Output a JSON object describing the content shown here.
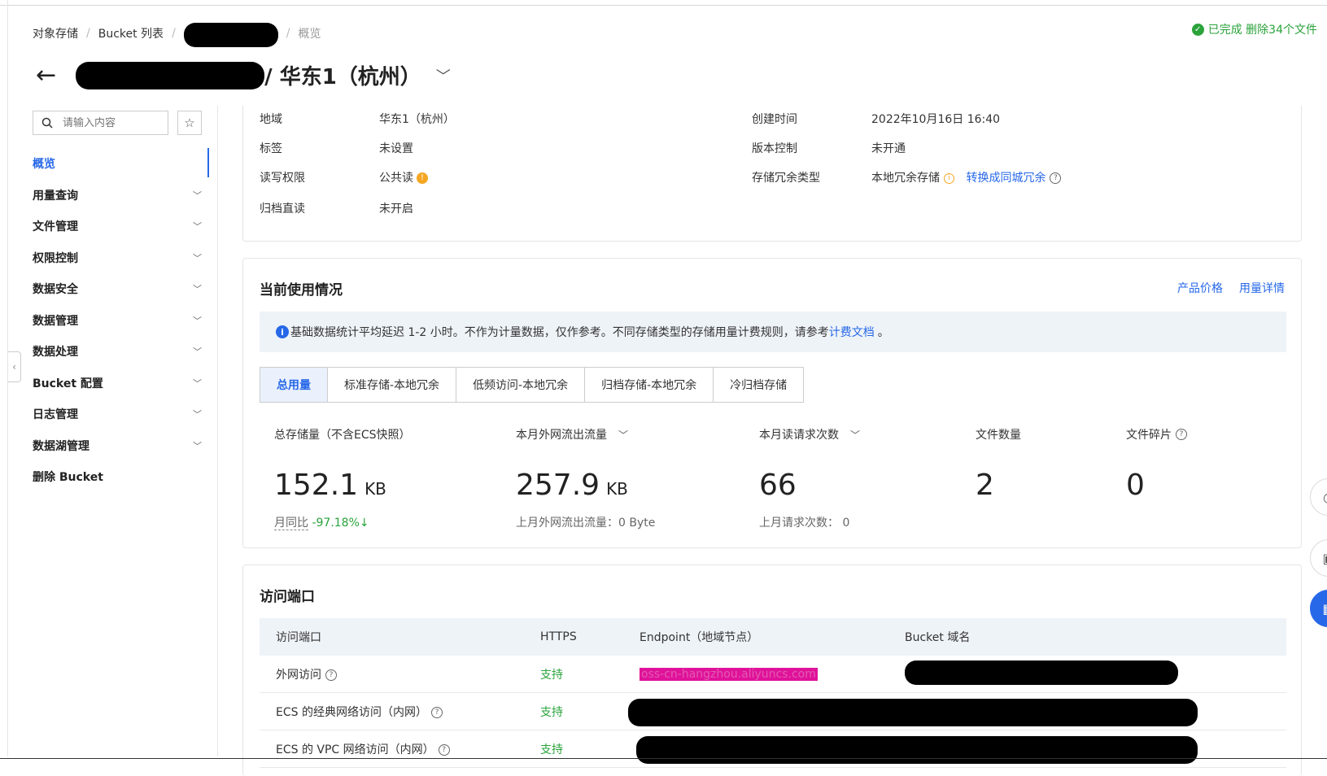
{
  "breadcrumb": {
    "items": [
      "对象存储",
      "Bucket 列表"
    ],
    "current": "概览"
  },
  "status": {
    "text": "已完成 删除34个文件"
  },
  "header": {
    "region_title": "/ 华东1（杭州）"
  },
  "sidebar": {
    "search_placeholder": "请输入内容",
    "items": [
      {
        "label": "概览"
      },
      {
        "label": "用量查询"
      },
      {
        "label": "文件管理"
      },
      {
        "label": "权限控制"
      },
      {
        "label": "数据安全"
      },
      {
        "label": "数据管理"
      },
      {
        "label": "数据处理"
      },
      {
        "label": "Bucket 配置"
      },
      {
        "label": "日志管理"
      },
      {
        "label": "数据湖管理"
      },
      {
        "label": "删除 Bucket"
      }
    ]
  },
  "basic_info": {
    "region_label": "地域",
    "region_value": "华东1（杭州）",
    "tags_label": "标签",
    "tags_value": "未设置",
    "acl_label": "读写权限",
    "acl_value": "公共读",
    "archive_label": "归档直读",
    "archive_value": "未开启",
    "created_label": "创建时间",
    "created_value": "2022年10月16日 16:40",
    "versioning_label": "版本控制",
    "versioning_value": "未开通",
    "redundancy_label": "存储冗余类型",
    "redundancy_value": "本地冗余存储",
    "redundancy_link": "转换成同城冗余"
  },
  "usage": {
    "title": "当前使用情况",
    "link_price": "产品价格",
    "link_detail": "用量详情",
    "notice_text": "基础数据统计平均延迟 1-2 小时。不作为计量数据，仅作参考。不同存储类型的存储用量计费规则，请参考",
    "notice_link": "计费文档",
    "notice_end": "。",
    "tabs": [
      "总用量",
      "标准存储-本地冗余",
      "低频访问-本地冗余",
      "归档存储-本地冗余",
      "冷归档存储"
    ],
    "stats": {
      "storage_label": "总存储量（不含ECS快照）",
      "storage_value": "152.1",
      "storage_unit": "KB",
      "storage_sub_label": "月同比",
      "storage_sub_value": "-97.18%",
      "traffic_label": "本月外网流出流量",
      "traffic_value": "257.9",
      "traffic_unit": "KB",
      "traffic_sub": "上月外网流出流量：0 Byte",
      "requests_label": "本月读请求次数",
      "requests_value": "66",
      "requests_sub": "上月请求次数：  0",
      "files_label": "文件数量",
      "files_value": "2",
      "fragments_label": "文件碎片",
      "fragments_value": "0"
    }
  },
  "endpoints": {
    "title": "访问端口",
    "headers": [
      "访问端口",
      "HTTPS",
      "Endpoint（地域节点）",
      "Bucket 域名"
    ],
    "rows": [
      {
        "name": "外网访问",
        "https": "支持",
        "endpoint": "oss-cn-hangzhou.aliyuncs.com"
      },
      {
        "name": "ECS 的经典网络访问（内网）",
        "https": "支持"
      },
      {
        "name": "ECS 的 VPC 网络访问（内网）",
        "https": "支持"
      }
    ]
  },
  "colors": {
    "accent": "#2768e8",
    "success": "#2aa33b",
    "warning": "#f5a623"
  }
}
